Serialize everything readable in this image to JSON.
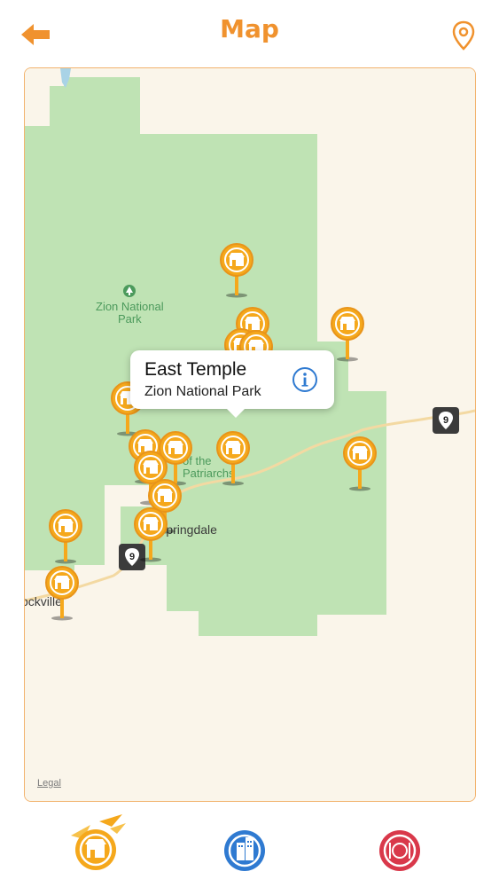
{
  "header": {
    "title": "Map",
    "back_icon": "arrow-left-icon",
    "location_icon": "map-pin-icon",
    "accent_color": "#f0922e"
  },
  "map": {
    "park_label": "Zion National Park",
    "labels": {
      "zion_park_line1": "Zion National",
      "zion_park_line2": "Park",
      "patriarchs_line1": "of the",
      "patriarchs_line2": "Patriarchs",
      "springdale": "Springdale",
      "rockville": "ockville"
    },
    "route_shield_number": "9",
    "legal": "Legal",
    "land_color": "#faf5ea",
    "park_color": "#bfe3b4",
    "pin_color": "#f5a81c",
    "pin_icon": "shop-icon"
  },
  "callout": {
    "title": "East Temple",
    "subtitle": "Zion National Park",
    "info_icon": "info-icon"
  },
  "tabbar": {
    "tabs": [
      {
        "name": "shops",
        "icon": "shop-icon",
        "color": "#f5a81c"
      },
      {
        "name": "hotels",
        "icon": "building-icon",
        "color": "#2f7ad1"
      },
      {
        "name": "restaurants",
        "icon": "plate-cutlery-icon",
        "color": "#d9384a"
      }
    ]
  }
}
